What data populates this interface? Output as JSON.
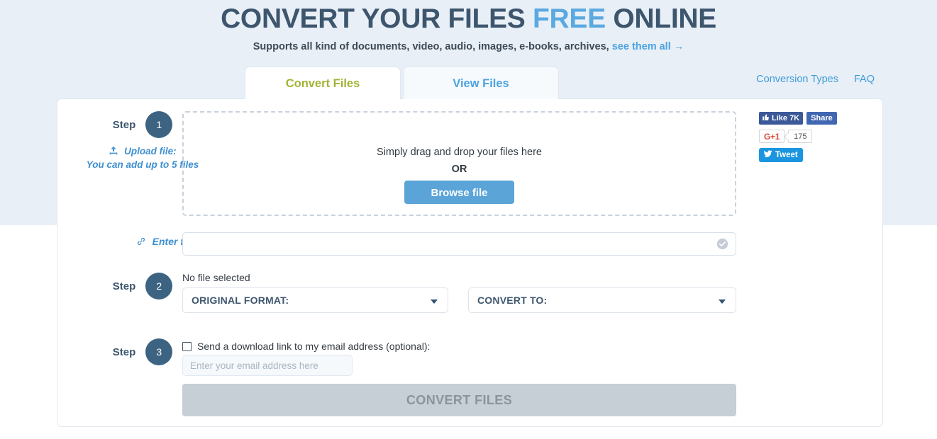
{
  "header": {
    "title_part1": "CONVERT YOUR FILES ",
    "title_free": "FREE",
    "title_part2": " ONLINE",
    "subtitle": "Supports all kind of documents, video, audio, images, e-books, archives, ",
    "see_all": "see them all →"
  },
  "tabs": [
    {
      "label": "Convert Files",
      "active": true
    },
    {
      "label": "View Files",
      "active": false
    }
  ],
  "topnav": [
    {
      "label": "Conversion Types"
    },
    {
      "label": "FAQ"
    }
  ],
  "steps": [
    {
      "word": "Step",
      "number": "1",
      "sub_icon": "upload-icon",
      "sub_label": "Upload file:",
      "sub_note": "You can add up to 5 files"
    },
    {
      "word": "Step",
      "number": "2"
    },
    {
      "word": "Step",
      "number": "3"
    }
  ],
  "dropzone": {
    "text": "Simply drag and drop your files here",
    "or": "OR",
    "browse_label": "Browse file"
  },
  "url_row": {
    "icon": "link-icon",
    "label": "Enter file url:",
    "value": "",
    "placeholder": "",
    "check_icon": "check-circle-icon"
  },
  "step2": {
    "no_file_text": "No file selected",
    "original_format_label": "ORIGINAL FORMAT:",
    "convert_to_label": "CONVERT TO:"
  },
  "step3": {
    "checkbox_label": "Send a download link to my email address (optional):",
    "checkbox_checked": false,
    "email_value": "",
    "email_placeholder": "Enter your email address here"
  },
  "convert_button": {
    "label": "CONVERT FILES",
    "disabled": true
  },
  "social": {
    "facebook_like": "Like 7K",
    "facebook_share": "Share",
    "gplus_label": "G+1",
    "gplus_count": "175",
    "tweet_label": "Tweet"
  },
  "colors": {
    "band": "#e9eff7",
    "title": "#3d566e",
    "accent_blue": "#5aa9e0",
    "tab_active": "#a3b334",
    "tab_inactive": "#4aa3e0",
    "step_circle": "#3c6382",
    "browse_button": "#5ba4d8",
    "convert_disabled": "#c6ced6",
    "facebook": "#3b5998",
    "gplus_red": "#dd4b39",
    "twitter": "#1b95e0"
  }
}
